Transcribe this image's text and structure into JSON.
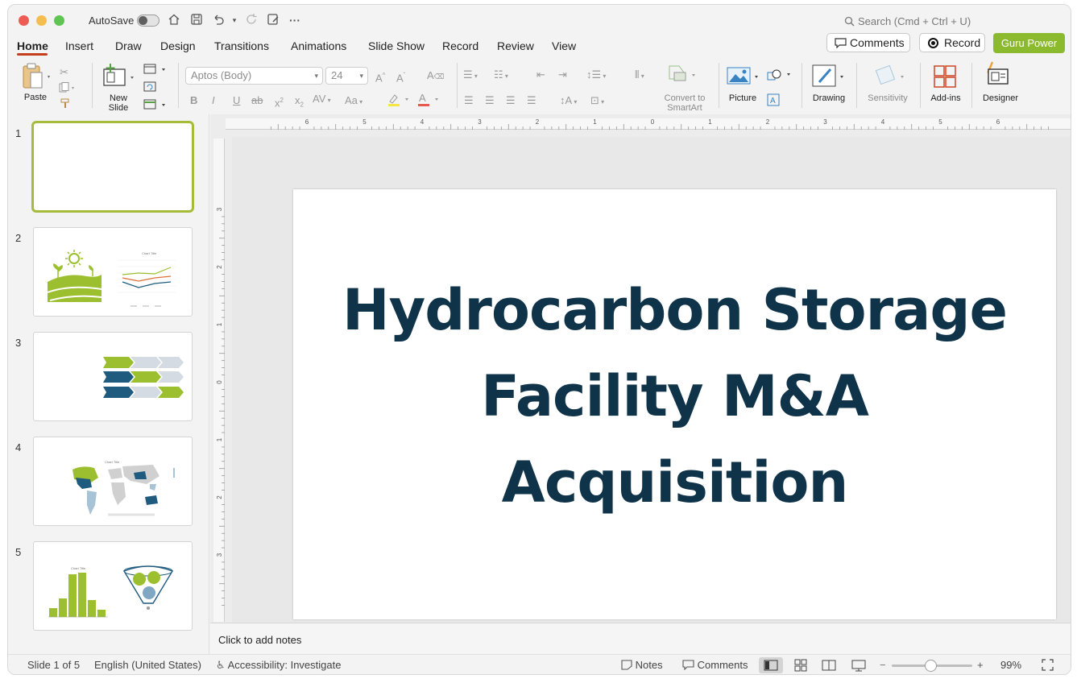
{
  "titlebar": {
    "autosave_label": "AutoSave",
    "search_placeholder": "Search (Cmd + Ctrl + U)"
  },
  "tabs": [
    "Home",
    "Insert",
    "Draw",
    "Design",
    "Transitions",
    "Animations",
    "Slide Show",
    "Record",
    "Review",
    "View"
  ],
  "active_tab": "Home",
  "header_buttons": {
    "comments": "Comments",
    "record": "Record",
    "guru": "Guru Power"
  },
  "ribbon": {
    "paste": "Paste",
    "new_slide_1": "New",
    "new_slide_2": "Slide",
    "font_name": "Aptos (Body)",
    "font_size": "24",
    "convert_1": "Convert to",
    "convert_2": "SmartArt",
    "picture": "Picture",
    "drawing": "Drawing",
    "sensitivity": "Sensitivity",
    "addins": "Add-ins",
    "designer": "Designer"
  },
  "slides": [
    {
      "number": "1"
    },
    {
      "number": "2",
      "mini_title": "Chart Title"
    },
    {
      "number": "3"
    },
    {
      "number": "4",
      "mini_title": "Chart Title"
    },
    {
      "number": "5",
      "mini_title": "Chart Title"
    }
  ],
  "ruler": {
    "h_labels": [
      "6",
      "5",
      "4",
      "3",
      "2",
      "1",
      "0",
      "1",
      "2",
      "3",
      "4",
      "5",
      "6"
    ],
    "v_labels": [
      "3",
      "2",
      "1",
      "0",
      "1",
      "2",
      "3"
    ]
  },
  "slide": {
    "title_lines": [
      "Hydrocarbon Storage",
      "Facility M&A",
      "Acquisition"
    ],
    "title_color": "#0f3349"
  },
  "notes": {
    "placeholder": "Click to add notes"
  },
  "status": {
    "slide_indicator": "Slide 1 of 5",
    "language": "English (United States)",
    "accessibility": "Accessibility: Investigate",
    "notes": "Notes",
    "comments": "Comments",
    "zoom_minus": "−",
    "zoom_plus": "+",
    "zoom": "99%"
  },
  "colors": {
    "accent_green": "#8cba2f",
    "tab_underline": "#c43e1c",
    "navy": "#0f3349",
    "teal": "#1f5b7f"
  }
}
